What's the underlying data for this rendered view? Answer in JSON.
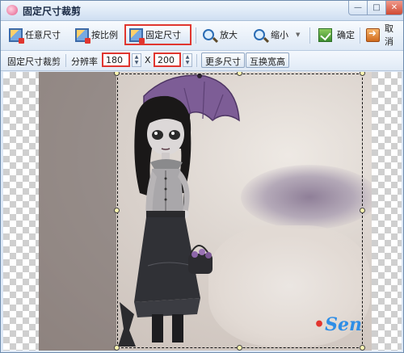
{
  "window": {
    "title": "固定尺寸裁剪",
    "controls": {
      "minimize": "—",
      "maximize": "□",
      "close": "✕"
    }
  },
  "toolbar": {
    "buttons": [
      {
        "id": "free",
        "label": "任意尺寸",
        "icon": "crop-icon"
      },
      {
        "id": "ratio",
        "label": "按比例",
        "icon": "crop-icon"
      },
      {
        "id": "fixed",
        "label": "固定尺寸",
        "icon": "crop-icon",
        "active": true
      },
      {
        "id": "zoom_in",
        "label": "放大",
        "icon": "zoom-in-icon"
      },
      {
        "id": "zoom_out",
        "label": "缩小",
        "icon": "zoom-out-icon"
      },
      {
        "id": "confirm",
        "label": "确定",
        "icon": "confirm-icon"
      },
      {
        "id": "cancel",
        "label": "取消",
        "icon": "cancel-icon"
      }
    ],
    "dropdown_arrow": "▼"
  },
  "options": {
    "mode_label": "固定尺寸裁剪",
    "resolution_label": "分辨率",
    "width_value": "180",
    "separator": "X",
    "height_value": "200",
    "more_sizes_label": "更多尺寸",
    "swap_label": "互换宽高",
    "spin_up": "▲",
    "spin_down": "▼"
  },
  "canvas": {
    "watermark_text": "Sen",
    "accent_color": "#e0362f"
  }
}
